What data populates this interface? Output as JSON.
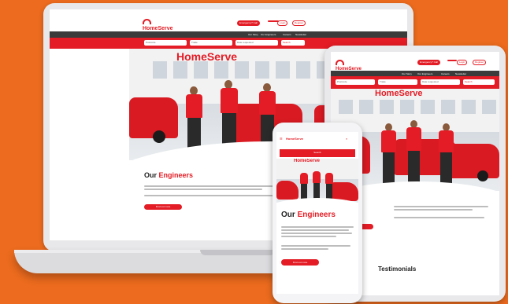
{
  "brand": {
    "name": "HomeServe",
    "accent": "#e31c25",
    "background": "#ec6b1e"
  },
  "header": {
    "cta_label": "Emergency? Call",
    "login_label": "Login",
    "register_label": "Register"
  },
  "nav": {
    "items": [
      "Our Story",
      "Our Engineers",
      "Careers",
      "Newsletter"
    ]
  },
  "search": {
    "field1": "Postcode",
    "field2": "Trade",
    "field3": "Date requested",
    "button": "Search"
  },
  "hero": {
    "sign": "HomeServe"
  },
  "section": {
    "title_plain": "Our",
    "title_accent": "Engineers",
    "button_label": "Find out more",
    "testimonials_label": "Testimonials"
  },
  "phone": {
    "top_button": "Search"
  }
}
